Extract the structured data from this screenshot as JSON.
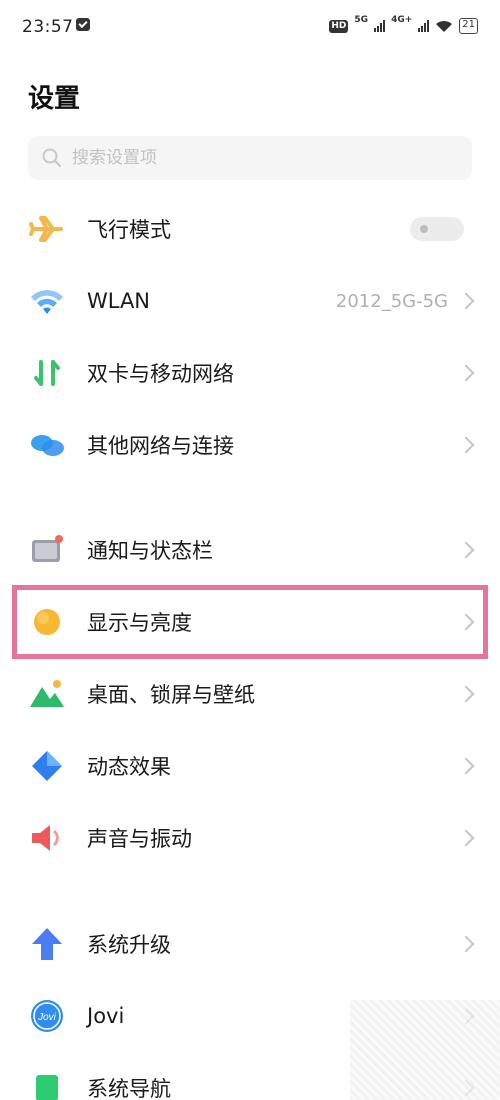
{
  "status_bar": {
    "time": "23:57",
    "hd_label": "HD",
    "net1_label": "5G",
    "net2_label": "4G+",
    "battery": "21"
  },
  "header": {
    "title": "设置"
  },
  "search": {
    "placeholder": "搜索设置项"
  },
  "settings": {
    "items": [
      {
        "label": "飞行模式",
        "icon": "airplane-icon",
        "toggle_on": false
      },
      {
        "label": "WLAN",
        "icon": "wifi-icon",
        "value": "2012_5G-5G"
      },
      {
        "label": "双卡与移动网络",
        "icon": "sim-network-icon"
      },
      {
        "label": "其他网络与连接",
        "icon": "connection-icon"
      },
      {
        "label": "通知与状态栏",
        "icon": "notification-icon"
      },
      {
        "label": "显示与亮度",
        "icon": "brightness-icon"
      },
      {
        "label": "桌面、锁屏与壁纸",
        "icon": "wallpaper-icon"
      },
      {
        "label": "动态效果",
        "icon": "dynamic-effect-icon"
      },
      {
        "label": "声音与振动",
        "icon": "sound-icon"
      },
      {
        "label": "系统升级",
        "icon": "upgrade-icon"
      },
      {
        "label": "Jovi",
        "icon": "jovi-icon",
        "icon_text": "Jovi"
      },
      {
        "label": "系统导航",
        "icon": "navigation-icon"
      }
    ]
  },
  "colors": {
    "highlight": "#e8739b",
    "airplane": "#f2b94a",
    "wifi": "#3f9ff5",
    "sim": "#39c46a",
    "connection": "#3aa0f0",
    "brightness": "#f7b733",
    "wallpaper": "#2dbb6b",
    "dynamic": "#2f7ff0",
    "sound": "#ee5a5a",
    "upgrade": "#4a7df0",
    "jovi": "#2f8df2",
    "navigation": "#2ecc71"
  }
}
